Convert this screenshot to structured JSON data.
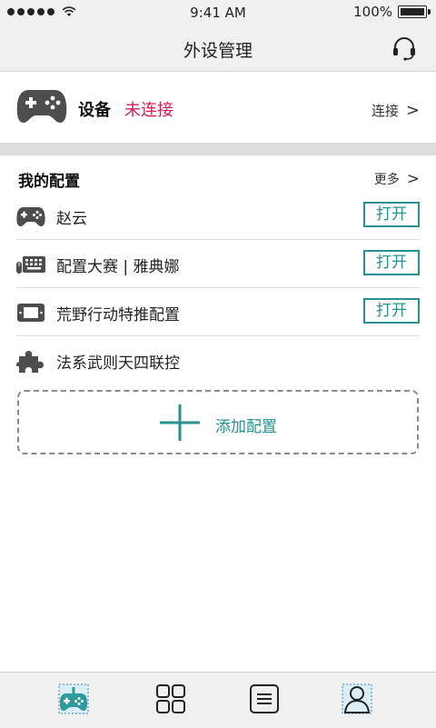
{
  "status_bar": {
    "time": "9:41 AM",
    "battery": "100%"
  },
  "nav": {
    "title": "外设管理",
    "headset_icon": "headset-icon"
  },
  "device": {
    "label": "设备",
    "status": "未连接",
    "connect": "连接",
    "status_color": "#d11f55"
  },
  "config": {
    "title": "我的配置",
    "more": "更多",
    "items": [
      {
        "name": "赵云",
        "icon": "gamepad-icon",
        "action": "打开"
      },
      {
        "name": "配置大赛 | 雅典娜",
        "icon": "keyboard-mouse-icon",
        "action": "打开"
      },
      {
        "name": "荒野行动特推配置",
        "icon": "tablet-icon",
        "action": "打开"
      },
      {
        "name": "法系武则天四联控",
        "icon": "puzzle-icon"
      }
    ],
    "add_label": "添加配置"
  },
  "accent_color": "#2a8f8f",
  "tabs": [
    {
      "name": "tab-controller",
      "icon": "gamepad-icon",
      "active": true
    },
    {
      "name": "tab-apps",
      "icon": "grid-icon"
    },
    {
      "name": "tab-list",
      "icon": "list-icon"
    },
    {
      "name": "tab-profile",
      "icon": "user-icon"
    }
  ]
}
